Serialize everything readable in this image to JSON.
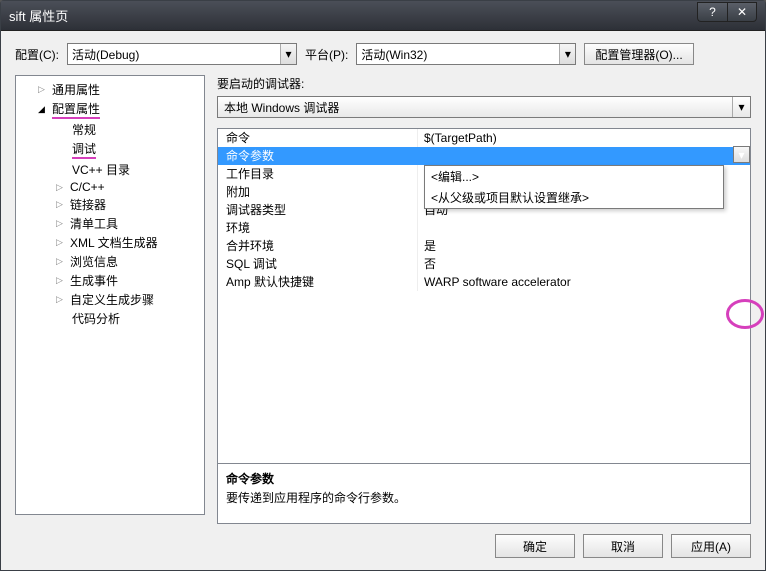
{
  "title": "sift 属性页",
  "config_label": "配置(C):",
  "config_value": "活动(Debug)",
  "platform_label": "平台(P):",
  "platform_value": "活动(Win32)",
  "config_manager_btn": "配置管理器(O)...",
  "tree": {
    "general": "通用属性",
    "config_props": "配置属性",
    "items": [
      "常规",
      "调试",
      "VC++ 目录",
      "C/C++",
      "链接器",
      "清单工具",
      "XML 文档生成器",
      "浏览信息",
      "生成事件",
      "自定义生成步骤",
      "代码分析"
    ]
  },
  "right_label": "要启动的调试器:",
  "debug_combo": "本地 Windows 调试器",
  "grid": [
    {
      "k": "命令",
      "v": "$(TargetPath)"
    },
    {
      "k": "命令参数",
      "v": ""
    },
    {
      "k": "工作目录",
      "v": ""
    },
    {
      "k": "附加",
      "v": ""
    },
    {
      "k": "调试器类型",
      "v": "自动"
    },
    {
      "k": "环境",
      "v": ""
    },
    {
      "k": "合并环境",
      "v": "是"
    },
    {
      "k": "SQL 调试",
      "v": "否"
    },
    {
      "k": "Amp 默认快捷键",
      "v": "WARP software accelerator"
    }
  ],
  "popup": {
    "edit": "<编辑...>",
    "inherit": "<从父级或项目默认设置继承>"
  },
  "desc": {
    "title": "命令参数",
    "body": "要传递到应用程序的命令行参数。"
  },
  "buttons": {
    "ok": "确定",
    "cancel": "取消",
    "apply": "应用(A)"
  }
}
